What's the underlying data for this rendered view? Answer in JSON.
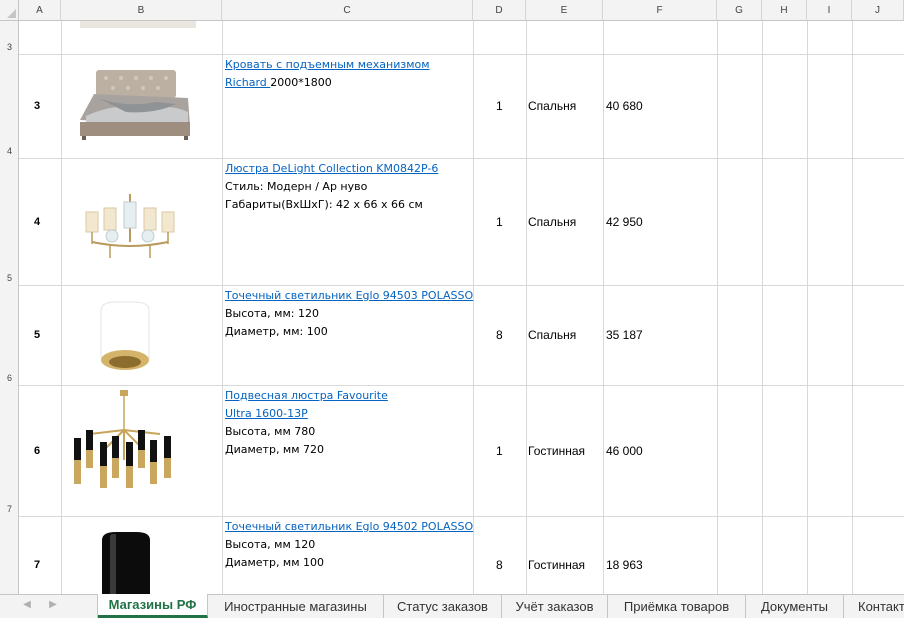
{
  "columns": [
    "A",
    "B",
    "C",
    "D",
    "E",
    "F",
    "G",
    "H",
    "I",
    "J"
  ],
  "row_headers": [
    "3",
    "4",
    "5",
    "6",
    "7"
  ],
  "rows": [
    {
      "num": "3",
      "desc": [
        {
          "text": "Кровать с подъемным механизмом ",
          "link": true
        },
        {
          "text": "Richard ",
          "link": true,
          "tail": "2000*1800"
        }
      ],
      "qty": "1",
      "room": "Спальня",
      "price": "40 680",
      "image": "bed-image"
    },
    {
      "num": "4",
      "desc": [
        {
          "text": "Люстра DeLight Collection KM0842P-6",
          "link": true
        },
        {
          "text": "Стиль: Модерн / Ар нуво",
          "link": false
        },
        {
          "text": "Габариты(ВхШхГ):  42 x 66 x 66 см",
          "link": false
        }
      ],
      "qty": "1",
      "room": "Спальня",
      "price": "42 950",
      "image": "chandelier-image"
    },
    {
      "num": "5",
      "desc": [
        {
          "text": "Точечный светильник Eglo 94503 POLASSO",
          "link": true
        },
        {
          "text": "Высота, мм: 120",
          "link": false
        },
        {
          "text": "Диаметр, мм: 100",
          "link": false
        }
      ],
      "qty": "8",
      "room": "Спальня",
      "price": "35 187",
      "image": "white-spotlight-image"
    },
    {
      "num": "6",
      "desc": [
        {
          "text": "Подвесная люстра Favourite ",
          "link": true
        },
        {
          "text": "Ultra 1600-13P",
          "link": true
        },
        {
          "text": "Высота, мм 780",
          "link": false
        },
        {
          "text": "Диаметр, мм 720",
          "link": false
        }
      ],
      "qty": "1",
      "room": "Гостинная",
      "price": "46 000",
      "image": "pendant-chandelier-image"
    },
    {
      "num": "7",
      "desc": [
        {
          "text": "Точечный светильник Eglo 94502 POLASSO",
          "link": true
        },
        {
          "text": "Высота, мм 120",
          "link": false
        },
        {
          "text": "Диаметр, мм 100",
          "link": false
        }
      ],
      "qty": "8",
      "room": "Гостинная",
      "price": "18 963",
      "image": "black-spotlight-image"
    }
  ],
  "tabs": [
    "Магазины РФ",
    "Иностранные магазины",
    "Статус заказов",
    "Учёт заказов",
    "Приёмка товаров",
    "Документы",
    "Контакты"
  ],
  "active_tab": "Магазины РФ",
  "colors": {
    "link": "#0563c1",
    "accent": "#217346",
    "grid": "#d9d9d9"
  }
}
